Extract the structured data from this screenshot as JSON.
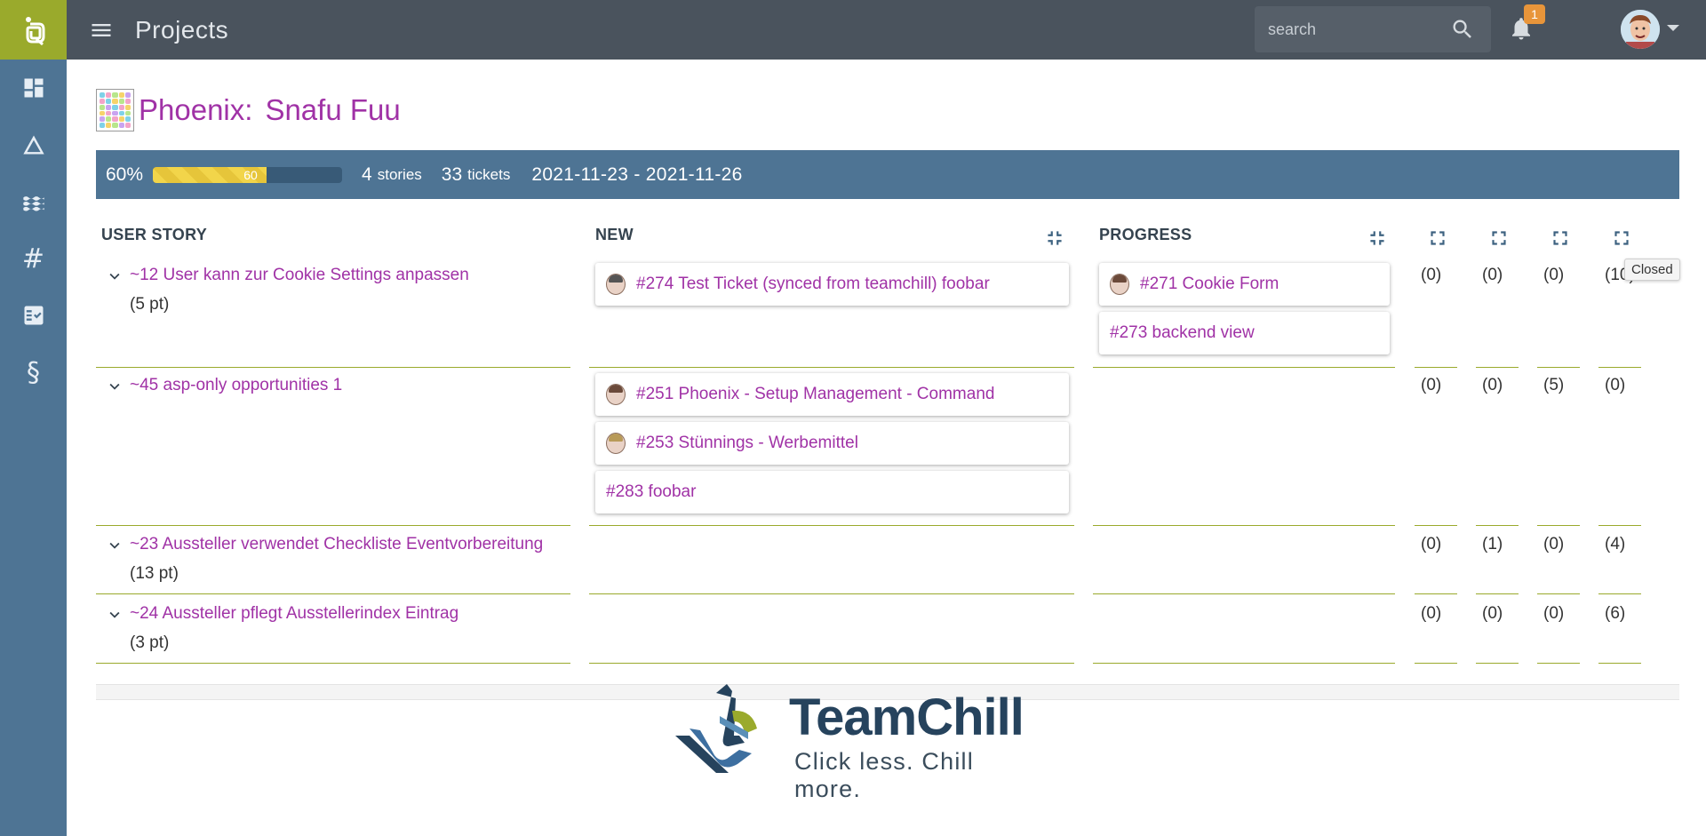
{
  "topbar": {
    "title": "Projects",
    "search_placeholder": "search",
    "notification_count": "1"
  },
  "sidebar": {
    "items": [
      {
        "icon": "dashboard-icon"
      },
      {
        "icon": "triangle-icon"
      },
      {
        "icon": "waves-icon"
      },
      {
        "icon": "hash-icon",
        "glyph": "#"
      },
      {
        "icon": "checklist-icon"
      },
      {
        "icon": "section-icon",
        "glyph": "§"
      }
    ]
  },
  "project": {
    "name": "Phoenix:",
    "sprint": "Snafu Fuu"
  },
  "stats": {
    "percent_label": "60%",
    "progress_value": 60,
    "progress_label": "60",
    "stories_count": "4",
    "stories_label": "stories",
    "tickets_count": "33",
    "tickets_label": "tickets",
    "date_range": "2021-11-23 - 2021-11-26"
  },
  "columns": {
    "story": "USER STORY",
    "new": "NEW",
    "progress": "PROGRESS"
  },
  "tooltip": "Closed",
  "stories": [
    {
      "title": "~12 User kann zur Cookie Settings anpassen",
      "points": "(5 pt)",
      "new_tickets": [
        "#274 Test Ticket (synced from teamchill) foobar"
      ],
      "progress_tickets": [
        "#271 Cookie Form",
        "#273 backend view"
      ],
      "counts": [
        "(0)",
        "(0)",
        "(0)",
        "(10)"
      ]
    },
    {
      "title": "~45 asp-only opportunities 1",
      "points": "",
      "new_tickets": [
        "#251 Phoenix - Setup Management - Command",
        "#253 Stünnings - Werbemittel",
        "#283 foobar"
      ],
      "progress_tickets": [],
      "counts": [
        "(0)",
        "(0)",
        "(5)",
        "(0)"
      ]
    },
    {
      "title": "~23 Aussteller verwendet Checkliste Eventvorbereitung",
      "points": "(13 pt)",
      "new_tickets": [],
      "progress_tickets": [],
      "counts": [
        "(0)",
        "(1)",
        "(0)",
        "(4)"
      ]
    },
    {
      "title": "~24 Aussteller pflegt Ausstellerindex Eintrag",
      "points": "(3 pt)",
      "new_tickets": [],
      "progress_tickets": [],
      "counts": [
        "(0)",
        "(0)",
        "(0)",
        "(6)"
      ]
    }
  ],
  "footer": {
    "brand_name": "TeamChill",
    "tagline": "Click less. Chill more."
  },
  "colors": {
    "sidebar": "#4e7494",
    "topbar": "#4a535d",
    "accent_green": "#9aaa2c",
    "link_purple": "#a032a6"
  }
}
